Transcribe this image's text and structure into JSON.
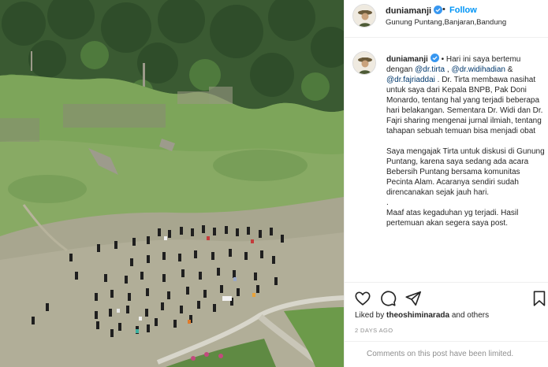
{
  "post": {
    "username": "duniamanji",
    "follow_label": "Follow",
    "dot": "•",
    "location": "Gunung Puntang,Banjaran,Bandung"
  },
  "caption": {
    "line1_pre": " • Hari ini saya bertemu dengan ",
    "mention1": "@dr.tirta",
    "sep1": " , ",
    "mention2": "@dr.widihadian",
    "sep2": " & ",
    "mention3": "@dr.fajriaddai",
    "body1": " . Dr. Tirta membawa nasihat untuk saya dari Kepala BNPB, Pak Doni Monardo, tentang hal yang terjadi beberapa hari belakangan. Sementara Dr. Widi dan Dr. Fajri sharing mengenai jurnal ilmiah, tentang tahapan sebuah temuan bisa menjadi obat",
    "para2": "Saya mengajak Tirta untuk diskusi di Gunung Puntang, karena saya sedang ada acara Bebersih Puntang bersama komunitas Pecinta Alam. Acaranya sendiri sudah direncanakan sejak jauh hari.",
    "para3": ".",
    "para4": "Maaf atas kegaduhan yg terjadi. Hasil pertemuan akan segera saya post."
  },
  "engagement": {
    "liked_prefix": "Liked by ",
    "liked_user": "theoshiminarada",
    "liked_suffix": " and others",
    "timestamp": "2 DAYS AGO",
    "comments_limited": "Comments on this post have been limited."
  },
  "icons": {
    "verified": "verified-badge-icon",
    "like": "heart-icon",
    "comment": "comment-icon",
    "share": "paper-plane-icon",
    "save": "bookmark-icon"
  },
  "colors": {
    "accent": "#0095f6",
    "verified": "#3897f0",
    "mention": "#00376b",
    "muted": "#8e8e8e"
  }
}
